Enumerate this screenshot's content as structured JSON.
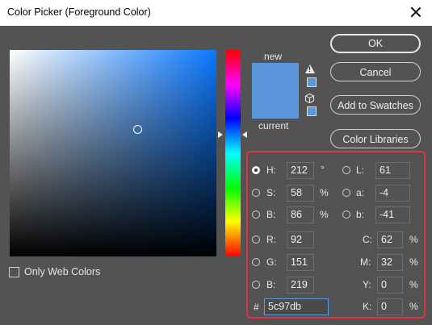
{
  "window": {
    "title": "Color Picker (Foreground Color)"
  },
  "colors": {
    "new": "#5c97db",
    "current": "#5c97db",
    "highlight": "#e03542"
  },
  "swatch": {
    "new_label": "new",
    "current_label": "current"
  },
  "buttons": {
    "ok": "OK",
    "cancel": "Cancel",
    "add_to_swatches": "Add to Swatches",
    "color_libraries": "Color Libraries"
  },
  "web_colors": {
    "label": "Only Web Colors",
    "checked": false
  },
  "fields": {
    "hsb": [
      {
        "label": "H:",
        "value": "212",
        "unit": "°",
        "selected": true
      },
      {
        "label": "S:",
        "value": "58",
        "unit": "%",
        "selected": false
      },
      {
        "label": "B:",
        "value": "86",
        "unit": "%",
        "selected": false
      }
    ],
    "lab": [
      {
        "label": "L:",
        "value": "61"
      },
      {
        "label": "a:",
        "value": "-4"
      },
      {
        "label": "b:",
        "value": "-41"
      }
    ],
    "rgb": [
      {
        "label": "R:",
        "value": "92"
      },
      {
        "label": "G:",
        "value": "151"
      },
      {
        "label": "B:",
        "value": "219"
      }
    ],
    "cmyk": [
      {
        "label": "C:",
        "value": "62",
        "unit": "%"
      },
      {
        "label": "M:",
        "value": "32",
        "unit": "%"
      },
      {
        "label": "Y:",
        "value": "0",
        "unit": "%"
      },
      {
        "label": "K:",
        "value": "0",
        "unit": "%"
      }
    ],
    "hex": {
      "label": "#",
      "value": "5c97db"
    }
  }
}
